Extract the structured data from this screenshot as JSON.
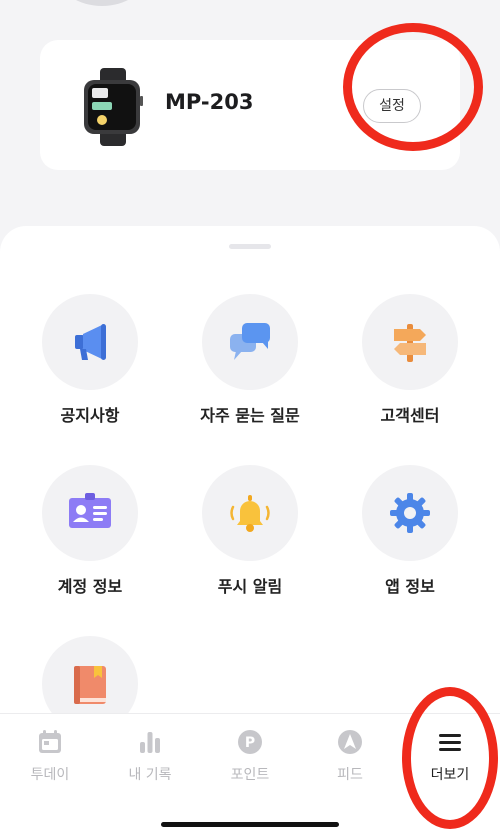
{
  "device": {
    "name": "MP-203",
    "settings_label": "설정"
  },
  "menu": {
    "items": [
      {
        "label": "공지사항",
        "icon": "megaphone-icon"
      },
      {
        "label": "자주 묻는 질문",
        "icon": "chat-bubbles-icon"
      },
      {
        "label": "고객센터",
        "icon": "signpost-icon"
      },
      {
        "label": "계정 정보",
        "icon": "id-card-icon"
      },
      {
        "label": "푸시 알림",
        "icon": "bell-icon"
      },
      {
        "label": "앱 정보",
        "icon": "gear-icon"
      },
      {
        "label": "",
        "icon": "book-icon"
      }
    ]
  },
  "tabbar": {
    "tabs": [
      {
        "label": "투데이",
        "icon": "calendar-icon"
      },
      {
        "label": "내 기록",
        "icon": "bar-chart-icon"
      },
      {
        "label": "포인트",
        "icon": "points-icon"
      },
      {
        "label": "피드",
        "icon": "feed-icon"
      },
      {
        "label": "더보기",
        "icon": "menu-icon"
      }
    ],
    "active": "더보기"
  },
  "colors": {
    "highlight": "#ef2a1c",
    "primary_blue": "#4c86e8",
    "orange": "#f4a85a",
    "purple": "#8d7cf5",
    "yellow": "#f9c23c"
  }
}
